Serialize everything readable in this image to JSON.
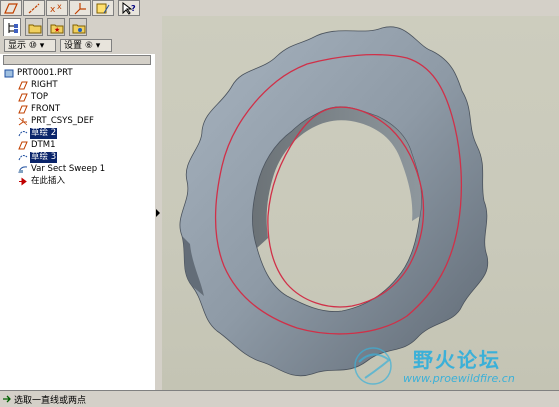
{
  "toolbar": {
    "icons": [
      "datum-plane-display-icon",
      "datum-axis-display-icon",
      "datum-point-display-icon",
      "csys-display-icon",
      "annotation-display-icon",
      "whats-this-help-icon"
    ]
  },
  "left_panel": {
    "tabs": [
      "model-tree-tab-icon",
      "folder-browser-tab-icon",
      "favorites-tab-icon",
      "connections-tab-icon"
    ],
    "show_menu": "显示 ⑩ ▾",
    "settings_menu": "设置 ⑥ ▾"
  },
  "model_tree": {
    "items": [
      {
        "label": "PRT0001.PRT",
        "icon": "part-icon",
        "selected": false
      },
      {
        "label": "RIGHT",
        "icon": "datum-plane-icon",
        "selected": false
      },
      {
        "label": "TOP",
        "icon": "datum-plane-icon",
        "selected": false
      },
      {
        "label": "FRONT",
        "icon": "datum-plane-icon",
        "selected": false
      },
      {
        "label": "PRT_CSYS_DEF",
        "icon": "coordinate-system-icon",
        "selected": false
      },
      {
        "label": "草绘 2",
        "icon": "sketch-icon",
        "selected": true
      },
      {
        "label": "DTM1",
        "icon": "datum-plane-icon",
        "selected": false
      },
      {
        "label": "草绘 3",
        "icon": "sketch-icon",
        "selected": true
      },
      {
        "label": "Var Sect Sweep 1",
        "icon": "sweep-feature-icon",
        "selected": false
      },
      {
        "label": "在此插入",
        "icon": "insert-here-arrow-icon",
        "selected": false
      }
    ]
  },
  "watermark": {
    "text_cn": "野火论坛",
    "url": "www.proewildfire.cn"
  },
  "status_bar": {
    "message": "选取一直线或两点"
  },
  "colors": {
    "selection": "#0a246a",
    "sketch_curve": "#d03048",
    "model_surface": "#8e9aa6",
    "watermark": "#3bb0d8"
  }
}
